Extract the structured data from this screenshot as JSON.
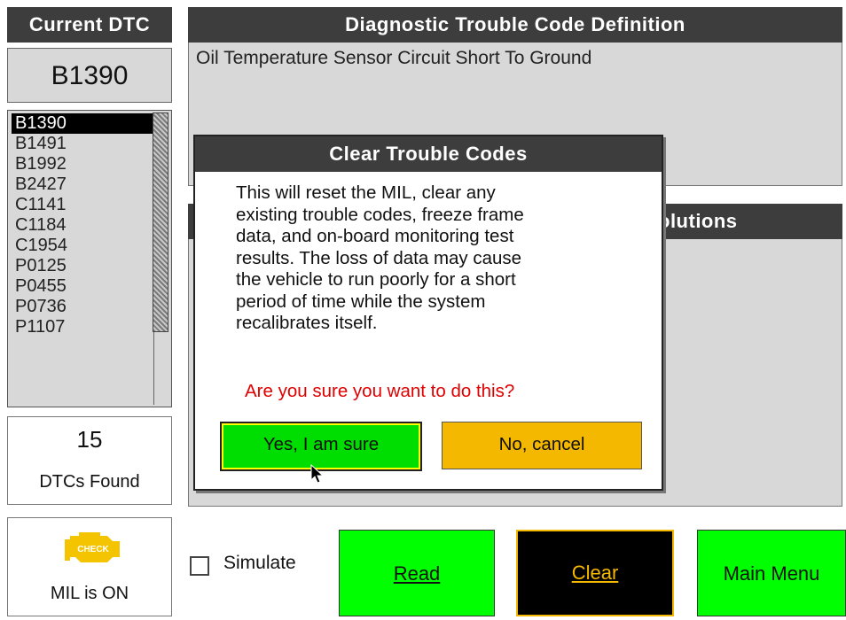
{
  "current_dtc": {
    "header": "Current DTC",
    "code": "B1390"
  },
  "dtc_list": {
    "items": [
      "B1390",
      "B1491",
      "B1992",
      "B2427",
      "C1141",
      "C1184",
      "C1954",
      "P0125",
      "P0455",
      "P0736",
      "P1107"
    ],
    "selected": "B1390"
  },
  "found": {
    "count": "15",
    "label": "DTCs Found"
  },
  "mil": {
    "icon": "check-engine-icon",
    "icon_text": "CHECK",
    "label": "MIL is ON",
    "icon_color": "#f5c400"
  },
  "definition": {
    "header": "Diagnostic Trouble Code Definition",
    "text": "Oil Temperature Sensor Circuit Short To Ground"
  },
  "solutions": {
    "header_visible_text": "olutions"
  },
  "simulate": {
    "label": "Simulate",
    "checked": false
  },
  "buttons": {
    "read": "Read",
    "clear": "Clear",
    "main_menu": "Main Menu"
  },
  "dialog": {
    "title": "Clear Trouble Codes",
    "message_lines": [
      "This will reset the MIL, clear any",
      "existing trouble codes, freeze frame",
      "data, and on-board monitoring test",
      "results. The loss of data may cause",
      "the vehicle to run poorly for a short",
      "period of time while the system",
      "recalibrates itself."
    ],
    "question": "Are you sure you want to do this?",
    "yes": "Yes, I am sure",
    "no": "No, cancel"
  },
  "colors": {
    "header_bg": "#3d3d3d",
    "panel_bg": "#d8d8d8",
    "green_button": "#00ff00",
    "amber": "#f5b800",
    "warning_text": "#e00000"
  }
}
